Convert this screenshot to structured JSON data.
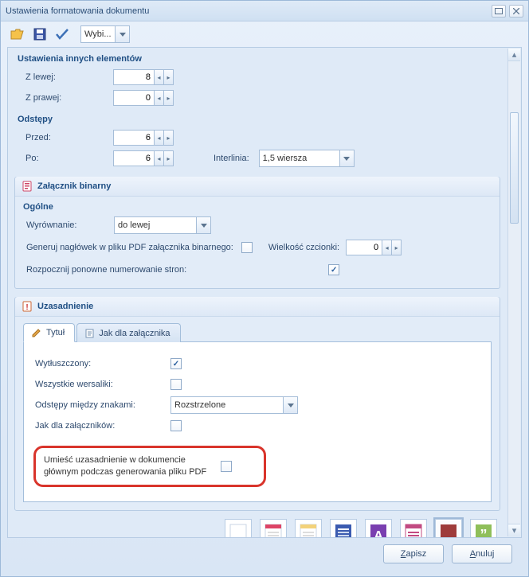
{
  "window": {
    "title": "Ustawienia formatowania dokumentu"
  },
  "toolbar": {
    "scheme_value": "Wybi..."
  },
  "sections": {
    "other_elements_title": "Ustawienia innych elementów",
    "spacing_title": "Odstępy"
  },
  "other_elements": {
    "from_left_label": "Z lewej:",
    "from_left_value": "8",
    "from_right_label": "Z prawej:",
    "from_right_value": "0"
  },
  "spacing": {
    "before_label": "Przed:",
    "before_value": "6",
    "after_label": "Po:",
    "after_value": "6",
    "interline_label": "Interlinia:",
    "interline_value": "1,5 wiersza"
  },
  "binary_attachment": {
    "title": "Załącznik binarny",
    "general_title": "Ogólne",
    "align_label": "Wyrównanie:",
    "align_value": "do lewej",
    "gen_header_label": "Generuj nagłówek w pliku PDF załącznika binarnego:",
    "gen_header_checked": false,
    "font_size_label": "Wielkość czcionki:",
    "font_size_value": "0",
    "restart_numbering_label": "Rozpocznij ponowne numerowanie stron:",
    "restart_numbering_checked": true
  },
  "justification": {
    "title": "Uzasadnienie",
    "tabs": {
      "title": "Tytuł",
      "like_attachment": "Jak dla załącznika"
    },
    "bold_label": "Wytłuszczony:",
    "bold_checked": true,
    "allcaps_label": "Wszystkie wersaliki:",
    "allcaps_checked": false,
    "letterspacing_label": "Odstępy między znakami:",
    "letterspacing_value": "Rozstrzelone",
    "like_att_label": "Jak dla załączników:",
    "like_att_checked": false,
    "callout_line1": "Umieść uzasadnienie w dokumencie",
    "callout_line2": "głównym podczas generowania pliku PDF",
    "callout_checked": false
  },
  "footer": {
    "save": "Zapisz",
    "cancel": "Anuluj"
  },
  "colors": {
    "accent": "#1f4f84",
    "highlight_border": "#d9342b"
  }
}
